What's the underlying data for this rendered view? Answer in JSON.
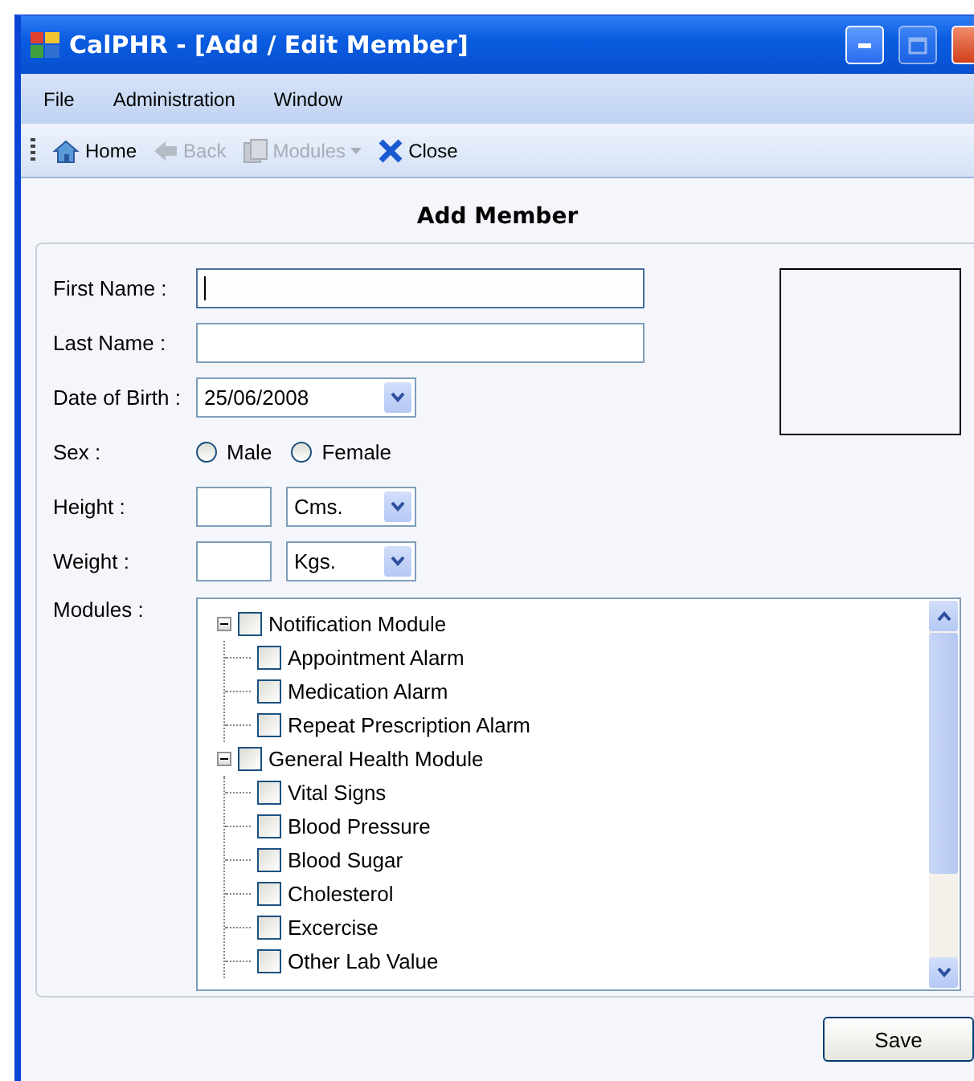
{
  "window": {
    "title": "CalPHR - [Add / Edit Member]"
  },
  "menu": [
    {
      "label": "File"
    },
    {
      "label": "Administration"
    },
    {
      "label": "Window"
    }
  ],
  "toolbar": [
    {
      "kind": "home",
      "label": "Home",
      "disabled": false
    },
    {
      "kind": "back",
      "label": "Back",
      "disabled": true
    },
    {
      "kind": "modules",
      "label": "Modules",
      "disabled": true
    },
    {
      "kind": "close",
      "label": "Close",
      "disabled": false
    }
  ],
  "heading": "Add Member",
  "fields": [
    {
      "kind": "text",
      "label": "First Name :",
      "focused": true
    },
    {
      "kind": "text",
      "label": "Last Name :",
      "focused": false
    },
    {
      "kind": "date",
      "label": "Date of Birth :",
      "value": "25/06/2008"
    },
    {
      "kind": "radio",
      "label": "Sex :",
      "options": [
        {
          "label": "Male",
          "selected": false
        },
        {
          "label": "Female",
          "selected": false
        }
      ]
    },
    {
      "kind": "measure",
      "label": "Height :",
      "unit": "Cms."
    },
    {
      "kind": "measure",
      "label": "Weight :",
      "unit": "Kgs."
    }
  ],
  "modules": {
    "label": "Modules :",
    "tree": [
      {
        "label": "Notification Module",
        "checked": false,
        "expanded": true,
        "children": [
          {
            "label": "Appointment Alarm",
            "checked": false
          },
          {
            "label": "Medication Alarm",
            "checked": false
          },
          {
            "label": "Repeat Prescription Alarm",
            "checked": false
          }
        ]
      },
      {
        "label": "General Health Module",
        "checked": false,
        "expanded": true,
        "children": [
          {
            "label": "Vital Signs",
            "checked": false
          },
          {
            "label": "Blood Pressure",
            "checked": false
          },
          {
            "label": "Blood Sugar",
            "checked": false
          },
          {
            "label": "Cholesterol",
            "checked": false
          },
          {
            "label": "Excercise",
            "checked": false
          },
          {
            "label": "Other Lab Value",
            "checked": false
          }
        ]
      }
    ]
  },
  "save_button": {
    "label": "Save"
  }
}
